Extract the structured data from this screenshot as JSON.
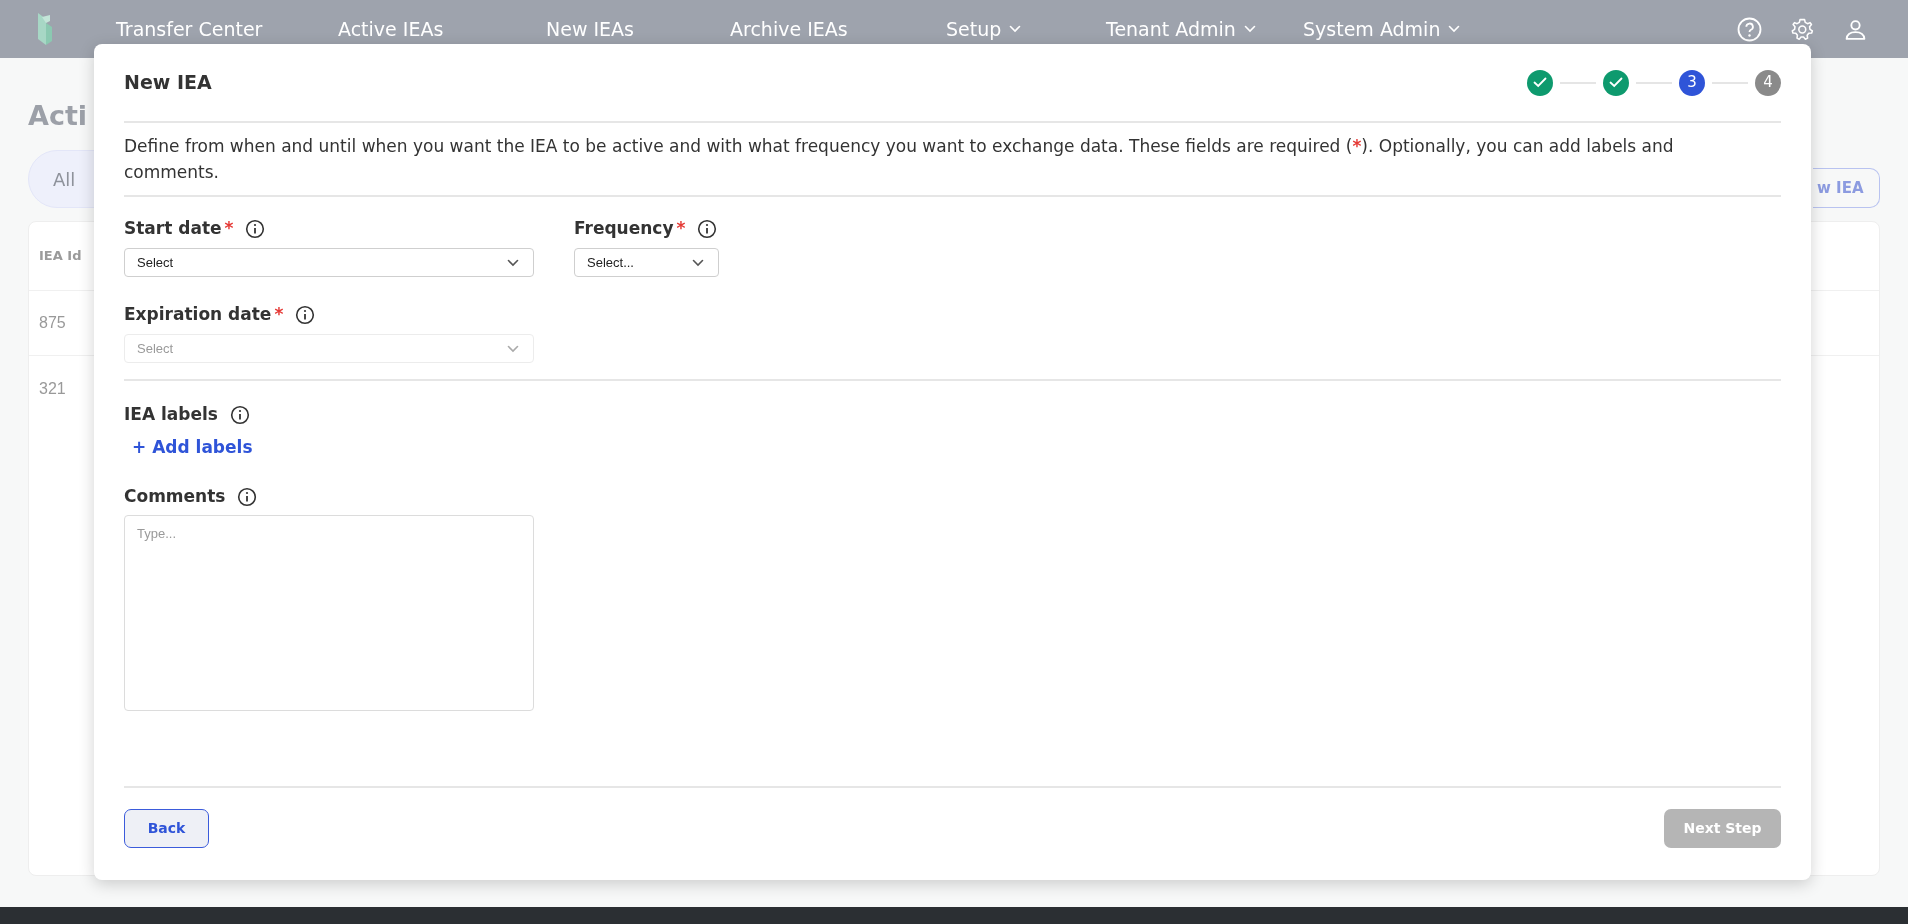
{
  "nav": {
    "items": [
      {
        "label": "Transfer Center",
        "has_menu": false
      },
      {
        "label": "Active IEAs",
        "has_menu": false
      },
      {
        "label": "New IEAs",
        "has_menu": false
      },
      {
        "label": "Archive IEAs",
        "has_menu": false
      },
      {
        "label": "Setup",
        "has_menu": true
      },
      {
        "label": "Tenant Admin",
        "has_menu": true
      },
      {
        "label": "System Admin",
        "has_menu": true
      }
    ]
  },
  "background_page": {
    "title": "Acti",
    "filter_pill": "All",
    "new_button": "w IEA",
    "table": {
      "column_1": "IEA Id",
      "rows": [
        "875",
        "321"
      ]
    }
  },
  "dialog": {
    "title": "New IEA",
    "steps": [
      {
        "kind": "done"
      },
      {
        "kind": "done"
      },
      {
        "label": "3",
        "kind": "current"
      },
      {
        "label": "4",
        "kind": "upcoming"
      }
    ],
    "description": {
      "before": "Define from when and until when you want the IEA to be active and with what frequency you want to exchange data. These fields are required (",
      "mark": "*",
      "after": "). Optionally, you can add labels and comments."
    },
    "fields": [
      {
        "label": "Start date",
        "required": true,
        "placeholder": "Select",
        "disabled": false
      },
      {
        "label": "Frequency",
        "required": true,
        "placeholder": "Select...",
        "disabled": false
      },
      {
        "label": "Expiration date",
        "required": true,
        "placeholder": "Select",
        "disabled": true
      }
    ],
    "labels_section": {
      "label": "IEA labels",
      "add_link": "+ Add labels"
    },
    "comments": {
      "label": "Comments",
      "placeholder": "Type..."
    },
    "back_button": {
      "label": "Back",
      "disabled": false
    },
    "next_button": {
      "label": "Next Step",
      "disabled": true
    }
  }
}
